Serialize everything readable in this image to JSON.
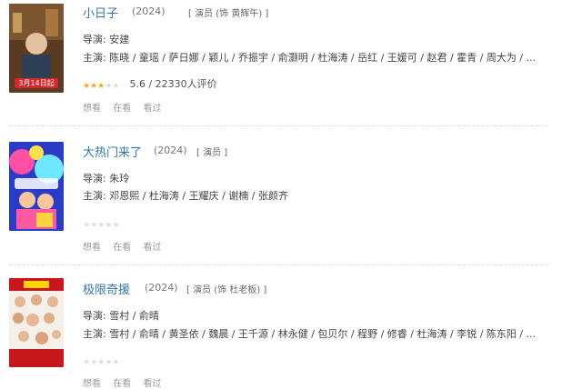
{
  "movies": [
    {
      "title": "小日子",
      "year": "(2024)",
      "role": "[ 演员 (饰 黄辉午) ]",
      "director_label": "导演:",
      "director": "安建",
      "cast_label": "主演:",
      "cast": "陈晓 / 童瑶 / 萨日娜 / 颖儿 / 乔振宇 / 俞灏明 / 杜海涛 / 岳红 / 王媛可 / 赵君 / 霍青 / 周大为 / ...",
      "rating_value": 2.8,
      "rating_text": "5.6 / 22330人评价",
      "poster_text": "3月14日起",
      "actions": [
        "想看",
        "在看",
        "看过"
      ]
    },
    {
      "title": "大热门来了",
      "year": "(2024)",
      "role": "[ 演员 ]",
      "director_label": "导演:",
      "director": "朱玲",
      "cast_label": "主演:",
      "cast": "邓恩熙 / 杜海涛 / 王耀庆 / 谢楠 / 张颜齐",
      "rating_value": 0,
      "rating_text": "",
      "poster_text": "",
      "actions": [
        "想看",
        "在看",
        "看过"
      ]
    },
    {
      "title": "极限奇援",
      "year": "(2024)",
      "role": "[ 演员 (饰 杜老板) ]",
      "director_label": "导演:",
      "director": "雪村 / 俞晴",
      "cast_label": "主演:",
      "cast": "雪村 / 俞晴 / 黄圣依 / 魏晨 / 王千源 / 林永健 / 包贝尔 / 程野 / 修睿 / 杜海涛 / 李锐 / 陈东阳 / ...",
      "rating_value": 0,
      "rating_text": "",
      "poster_text": "",
      "actions": [
        "想看",
        "在看",
        "看过"
      ]
    }
  ],
  "colors": {
    "link": "#3377aa",
    "star_on": "#f5a623",
    "star_off": "#dddddd"
  }
}
